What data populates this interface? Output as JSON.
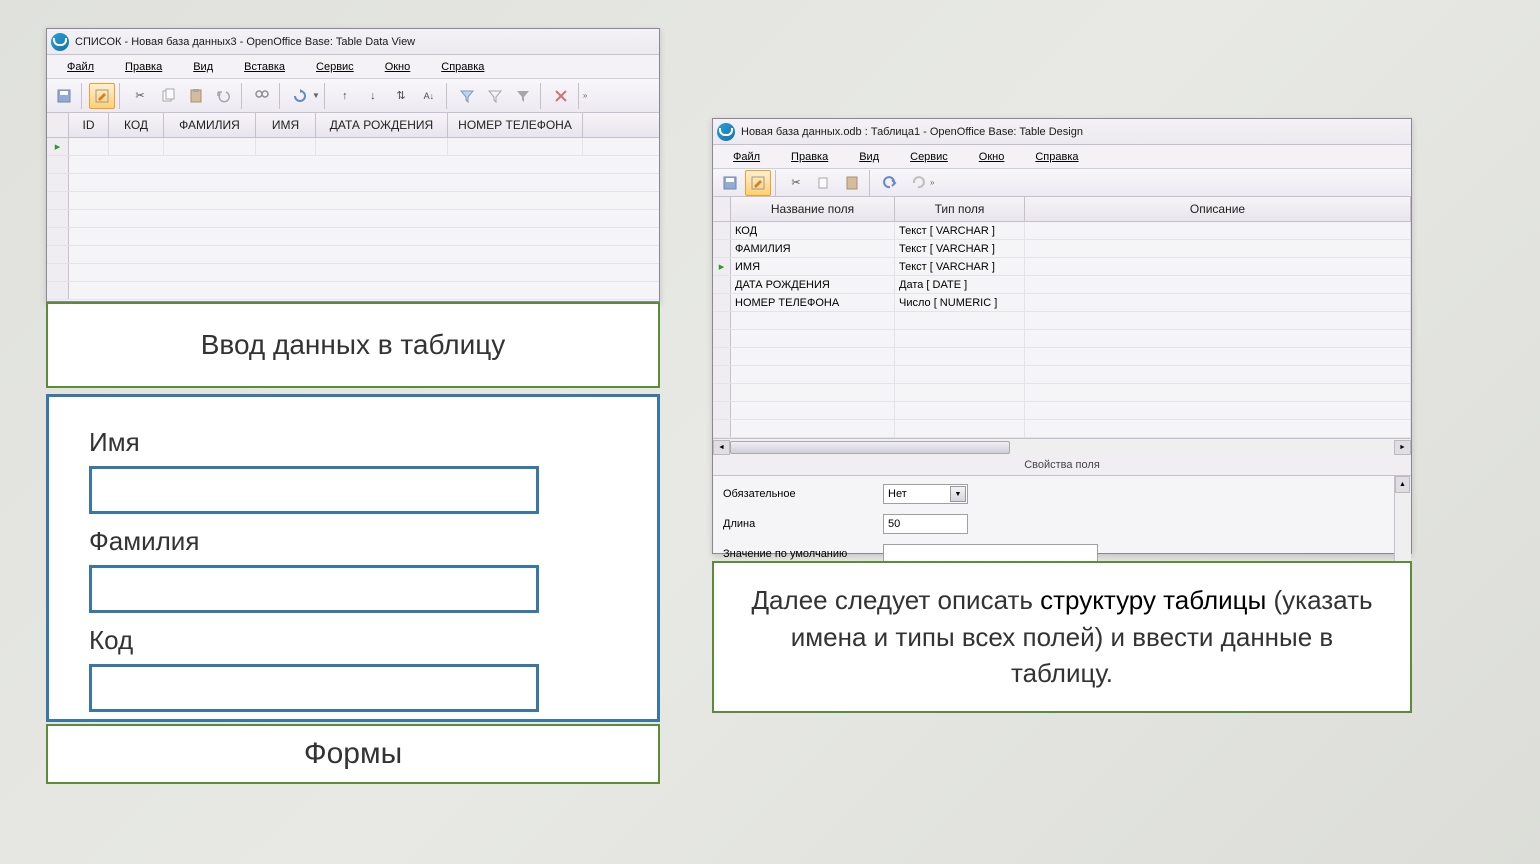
{
  "win1": {
    "title": "СПИСОК - Новая база данных3 - OpenOffice Base: Table Data View",
    "menu": [
      "Файл",
      "Правка",
      "Вид",
      "Вставка",
      "Сервис",
      "Окно",
      "Справка"
    ],
    "cols": [
      "ID",
      "КОД",
      "ФАМИЛИЯ",
      "ИМЯ",
      "ДАТА РОЖДЕНИЯ",
      "НОМЕР ТЕЛЕФОНА"
    ]
  },
  "win2": {
    "title": "Новая база данных.odb : Таблица1 - OpenOffice Base: Table Design",
    "menu": [
      "Файл",
      "Правка",
      "Вид",
      "Сервис",
      "Окно",
      "Справка"
    ],
    "hdr": {
      "name": "Название поля",
      "type": "Тип поля",
      "desc": "Описание"
    },
    "rows": [
      {
        "name": "КОД",
        "type": "Текст [ VARCHAR ]",
        "desc": ""
      },
      {
        "name": "ФАМИЛИЯ",
        "type": "Текст [ VARCHAR ]",
        "desc": ""
      },
      {
        "name": "ИМЯ",
        "type": "Текст [ VARCHAR ]",
        "desc": ""
      },
      {
        "name": "ДАТА РОЖДЕНИЯ",
        "type": "Дата [ DATE ]",
        "desc": ""
      },
      {
        "name": "НОМЕР ТЕЛЕФОНА",
        "type": "Число [ NUMERIC ]",
        "desc": ""
      }
    ],
    "props_title": "Свойства поля",
    "props": {
      "req_lbl": "Обязательное",
      "req_val": "Нет",
      "len_lbl": "Длина",
      "len_val": "50",
      "def_lbl": "Значение по умолчанию",
      "def_val": ""
    }
  },
  "ann": {
    "t1": "Ввод данных в таблицу",
    "form": {
      "l1": "Имя",
      "l2": "Фамилия",
      "l3": "Код"
    },
    "t2": "Формы",
    "t3_a": "Далее следует описать ",
    "t3_b": "структуру таблицы",
    "t3_c": " (указать имена и типы всех полей) и ввести данные в таблицу."
  }
}
